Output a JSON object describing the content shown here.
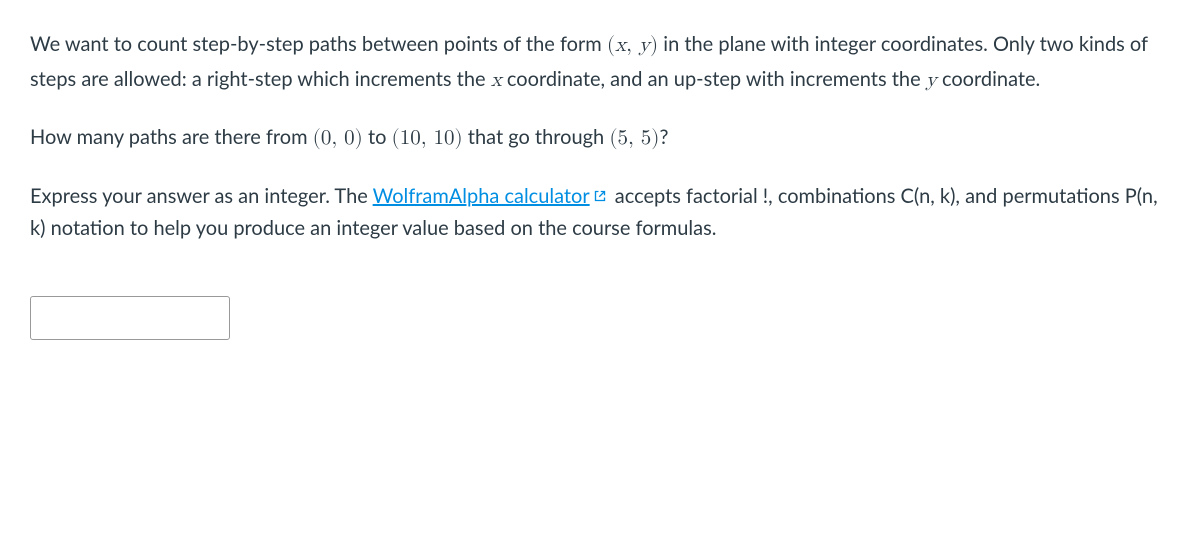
{
  "paragraph1": {
    "pre": "We want to count step-by-step paths between points of the form ",
    "math1_open": "(",
    "math1_x": "x",
    "math1_sep": ", ",
    "math1_y": "y",
    "math1_close": ")",
    "post1": " in the plane with integer coordinates. Only two kinds of steps are allowed: a right-step which increments the ",
    "math2_x": "x",
    "post2": " coordinate, and an up-step with increments the ",
    "math3_y": "y",
    "post3": " coordinate."
  },
  "paragraph2": {
    "pre": "How many paths are there from ",
    "m1": "(0, 0)",
    "mid1": " to ",
    "m2": "(10, 10)",
    "mid2": " that go through ",
    "m3": "(5, 5)",
    "post": "?"
  },
  "paragraph3": {
    "pre": "Express your answer as an integer. The ",
    "link_text": "WolframAlpha calculator",
    "post": " accepts factorial !, combinations C(n, k), and permutations P(n, k) notation to help you produce an integer value based on the course formulas."
  },
  "answer": {
    "value": "",
    "placeholder": ""
  }
}
